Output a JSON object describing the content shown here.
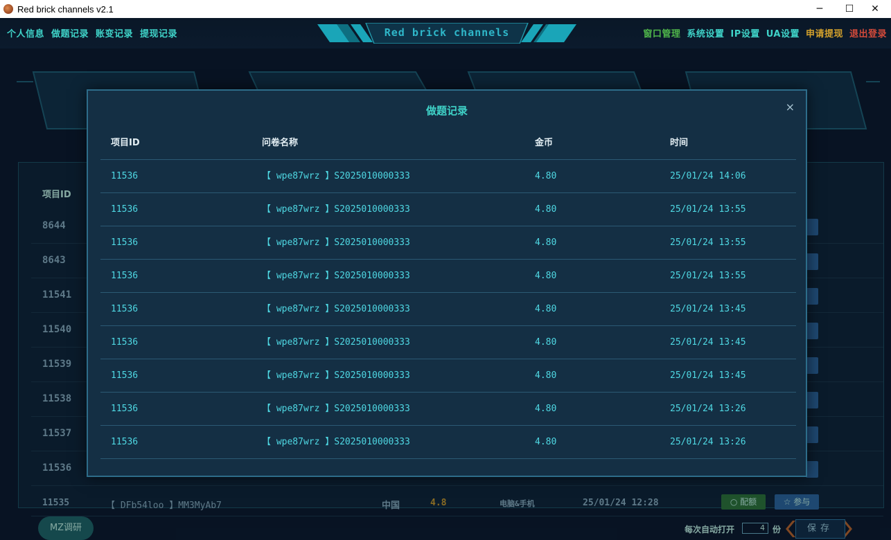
{
  "window": {
    "title": "Red brick channels v2.1",
    "minimize": "─",
    "maximize": "☐",
    "close": "✕"
  },
  "nav_left": [
    "个人信息",
    "做题记录",
    "账变记录",
    "提现记录"
  ],
  "logo": "Red brick channels",
  "nav_right": [
    {
      "label": "窗口管理",
      "color": "#4fb54a"
    },
    {
      "label": "系统设置",
      "color": "#3fd3c8"
    },
    {
      "label": "IP设置",
      "color": "#3fd3c8"
    },
    {
      "label": "UA设置",
      "color": "#3fd3c8"
    },
    {
      "label": "申请提现",
      "color": "#d2a02c"
    },
    {
      "label": "退出登录",
      "color": "#d34a3a"
    }
  ],
  "background_table": {
    "header": "项目ID",
    "ids": [
      "8644",
      "8643",
      "11541",
      "11540",
      "11539",
      "11538",
      "11537",
      "11536"
    ]
  },
  "modal": {
    "title": "做题记录",
    "close": "×",
    "columns": [
      "项目ID",
      "问卷名称",
      "金币",
      "时间"
    ],
    "rows": [
      [
        "11536",
        "【 wpe87wrz 】S2025010000333",
        "4.80",
        "25/01/24 14:06"
      ],
      [
        "11536",
        "【 wpe87wrz 】S2025010000333",
        "4.80",
        "25/01/24 13:55"
      ],
      [
        "11536",
        "【 wpe87wrz 】S2025010000333",
        "4.80",
        "25/01/24 13:55"
      ],
      [
        "11536",
        "【 wpe87wrz 】S2025010000333",
        "4.80",
        "25/01/24 13:55"
      ],
      [
        "11536",
        "【 wpe87wrz 】S2025010000333",
        "4.80",
        "25/01/24 13:45"
      ],
      [
        "11536",
        "【 wpe87wrz 】S2025010000333",
        "4.80",
        "25/01/24 13:45"
      ],
      [
        "11536",
        "【 wpe87wrz 】S2025010000333",
        "4.80",
        "25/01/24 13:45"
      ],
      [
        "11536",
        "【 wpe87wrz 】S2025010000333",
        "4.80",
        "25/01/24 13:26"
      ],
      [
        "11536",
        "【 wpe87wrz 】S2025010000333",
        "4.80",
        "25/01/24 13:26"
      ]
    ]
  },
  "bottom_row": {
    "id": "11535",
    "name": "【 DFb54loo 】MM3MyAb7",
    "country": "中国",
    "coins": "4.8",
    "device": "电脑&手机",
    "time": "25/01/24 12:28",
    "btn_config": "○ 配额",
    "btn_join": "☆ 参与"
  },
  "footer": {
    "mz_button": "MZ调研",
    "auto_label": "每次自动打开",
    "auto_value": "4",
    "auto_unit": "份",
    "save": "保存"
  }
}
